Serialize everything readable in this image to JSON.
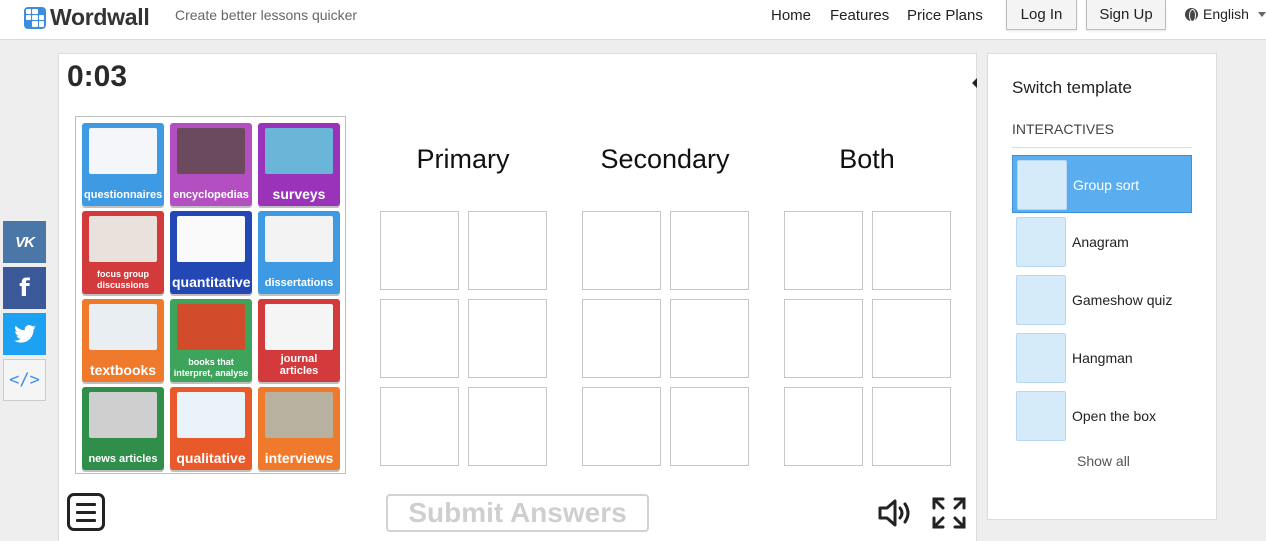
{
  "header": {
    "logo_text": "Wordwall",
    "tagline": "Create better lessons quicker",
    "nav": [
      "Home",
      "Features",
      "Price Plans"
    ],
    "login_label": "Log In",
    "signup_label": "Sign Up",
    "language": "English"
  },
  "social": [
    {
      "name": "vk",
      "glyph": "VK",
      "color": "#4a76a8"
    },
    {
      "name": "facebook",
      "glyph": "f",
      "color": "#3b5998"
    },
    {
      "name": "twitter",
      "glyph": "twitter-bird",
      "color": "#1da1f2"
    },
    {
      "name": "embed",
      "glyph": "</>",
      "color": "#f5f5f5"
    }
  ],
  "game": {
    "timer": "0:03",
    "columns": [
      "Primary",
      "Secondary",
      "Both"
    ],
    "submit_label": "Submit Answers",
    "cards": [
      {
        "label": "questionnaires",
        "color": "#3d9ae3",
        "pic": "#f4f6fa"
      },
      {
        "label": "encyclopedias",
        "color": "#b34fc1",
        "pic": "#6c4a5e"
      },
      {
        "label": "surveys",
        "color": "#9b33b8",
        "pic": "#6ab6d9"
      },
      {
        "label": "focus group discussions",
        "color": "#d23a3c",
        "pic": "#e9e2dc"
      },
      {
        "label": "quantitative",
        "color": "#2348b5",
        "pic": "#fafafa"
      },
      {
        "label": "dissertations",
        "color": "#3d9ae3",
        "pic": "#f3f3f3"
      },
      {
        "label": "textbooks",
        "color": "#ef7a2c",
        "pic": "#e9eef2"
      },
      {
        "label": "books that interpret, analyse",
        "color": "#3ea45c",
        "pic": "#d24b2a"
      },
      {
        "label": "journal articles",
        "color": "#d23a3c",
        "pic": "#f5f5f5"
      },
      {
        "label": "news articles",
        "color": "#2f8f4a",
        "pic": "#cfcfcf"
      },
      {
        "label": "qualitative",
        "color": "#e85a2a",
        "pic": "#eaf3fa"
      },
      {
        "label": "interviews",
        "color": "#ef7a2c",
        "pic": "#b9b1a0"
      }
    ]
  },
  "sidebar": {
    "title": "Switch template",
    "section": "INTERACTIVES",
    "templates": [
      {
        "label": "Group sort",
        "active": true
      },
      {
        "label": "Anagram",
        "active": false
      },
      {
        "label": "Gameshow quiz",
        "active": false
      },
      {
        "label": "Hangman",
        "active": false
      },
      {
        "label": "Open the box",
        "active": false
      }
    ],
    "show_all": "Show all"
  }
}
